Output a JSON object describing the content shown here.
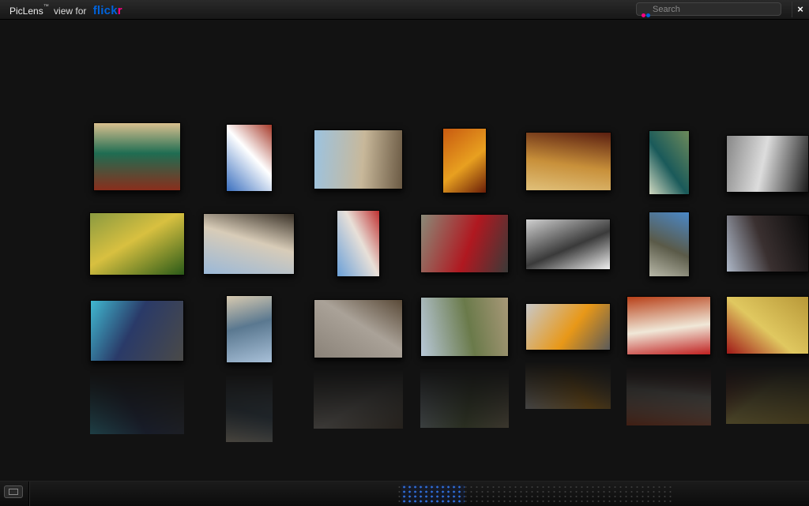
{
  "app": {
    "brand_name": "PicLens",
    "trademark": "™",
    "view_for": "view for",
    "service_logo": {
      "part1": "flick",
      "part2": "r",
      "color1": "#0063dc",
      "color2": "#ff0084"
    }
  },
  "search": {
    "placeholder": "Search",
    "icon": "flickr-dots-icon"
  },
  "close_button": {
    "label": "×"
  },
  "colors": {
    "background": "#121212",
    "accent": "#2d6fe0"
  },
  "wall": {
    "photos": [
      {
        "subject": "person-on-green-stairs",
        "colors": [
          "#8a2e1c",
          "#1f6d52",
          "#d9c08f"
        ]
      },
      {
        "subject": "red-white-lighthouse",
        "colors": [
          "#3a6fbf",
          "#ffffff",
          "#a63a2a"
        ]
      },
      {
        "subject": "beach-boardwalk-bench",
        "colors": [
          "#9cc3e0",
          "#c8b89a",
          "#6b5a44"
        ]
      },
      {
        "subject": "spiral-staircase-orange",
        "colors": [
          "#c85a10",
          "#e8a020",
          "#6a1e08"
        ]
      },
      {
        "subject": "golden-ornaments",
        "colors": [
          "#5a1e10",
          "#c8903a",
          "#e0c07a"
        ]
      },
      {
        "subject": "green-pool-fence",
        "colors": [
          "#6d8a5a",
          "#1a5a5a",
          "#d0d8c0"
        ]
      },
      {
        "subject": "playing-cards-bw",
        "colors": [
          "#1a1a1a",
          "#dddddd",
          "#888888"
        ]
      },
      {
        "subject": "plush-toy-dandelions",
        "colors": [
          "#2a5a18",
          "#d8c040",
          "#8a9a40"
        ]
      },
      {
        "subject": "beach-dune-fence",
        "colors": [
          "#9ab8d8",
          "#d8ccb8",
          "#3a3228"
        ]
      },
      {
        "subject": "warning-sign-sky",
        "colors": [
          "#6aa0d8",
          "#e8e0d8",
          "#c03030"
        ]
      },
      {
        "subject": "red-sports-car",
        "colors": [
          "#8a8a78",
          "#b01820",
          "#3a3a38"
        ]
      },
      {
        "subject": "building-bw-river",
        "colors": [
          "#d0d0d0",
          "#3a3a3a",
          "#f0f0f0"
        ]
      },
      {
        "subject": "tall-building-sky",
        "colors": [
          "#4a88c8",
          "#5a5a48",
          "#b8b8a8"
        ]
      },
      {
        "subject": "photographer-camera",
        "colors": [
          "#0a0a0a",
          "#3a3030",
          "#aeb8c8"
        ]
      },
      {
        "subject": "sneakers-on-asphalt",
        "colors": [
          "#4a4a48",
          "#2a3a68",
          "#40b8d0"
        ]
      },
      {
        "subject": "person-on-beach",
        "colors": [
          "#a8c0d8",
          "#5a7890",
          "#d8cab0"
        ]
      },
      {
        "subject": "snail-shell-concrete",
        "colors": [
          "#8a8278",
          "#aaa298",
          "#5a4a38"
        ]
      },
      {
        "subject": "field-sculpture-trees",
        "colors": [
          "#b8c8d8",
          "#6a7a4a",
          "#a89878"
        ]
      },
      {
        "subject": "yellow-car-street",
        "colors": [
          "#c8c8c8",
          "#e89818",
          "#5a5a5a"
        ]
      },
      {
        "subject": "playing-cards-red",
        "colors": [
          "#b84018",
          "#f0e8d8",
          "#c02020"
        ]
      },
      {
        "subject": "red-ribbon-bow",
        "colors": [
          "#b89838",
          "#e0c860",
          "#a01818"
        ]
      }
    ]
  },
  "bottom_bar": {
    "fullscreen_icon": "fullscreen-icon",
    "scroll_position": 0.22
  }
}
